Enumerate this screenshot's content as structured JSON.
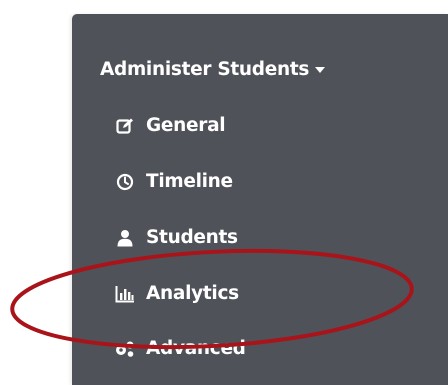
{
  "menu": {
    "title": "Administer Students",
    "items": [
      {
        "label": "General",
        "icon": "edit-icon"
      },
      {
        "label": "Timeline",
        "icon": "clock-icon"
      },
      {
        "label": "Students",
        "icon": "user-icon"
      },
      {
        "label": "Analytics",
        "icon": "bar-chart-icon"
      },
      {
        "label": "Advanced",
        "icon": "cogs-icon"
      }
    ]
  },
  "colors": {
    "panel_background": "#4f5258",
    "menu_text": "#ffffff",
    "annotation_ring": "#a8141a"
  }
}
